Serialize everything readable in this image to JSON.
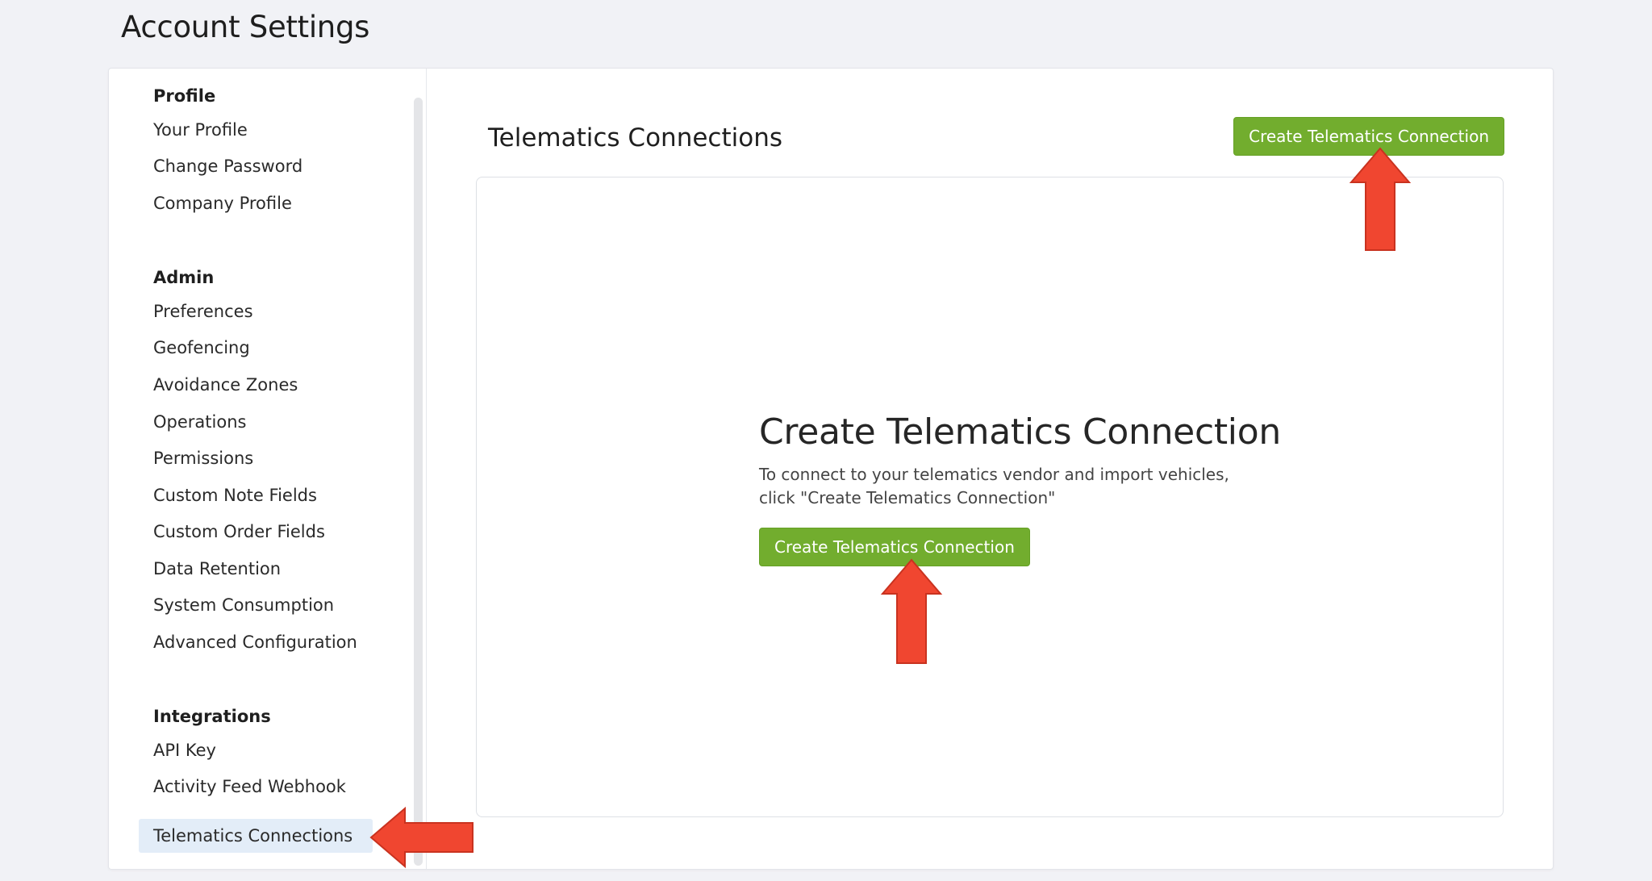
{
  "page": {
    "title": "Account Settings"
  },
  "sidebar": {
    "groups": [
      {
        "heading": "Profile",
        "items": [
          {
            "label": "Your Profile"
          },
          {
            "label": "Change Password"
          },
          {
            "label": "Company Profile"
          }
        ]
      },
      {
        "heading": "Admin",
        "items": [
          {
            "label": "Preferences"
          },
          {
            "label": "Geofencing"
          },
          {
            "label": "Avoidance Zones"
          },
          {
            "label": "Operations"
          },
          {
            "label": "Permissions"
          },
          {
            "label": "Custom Note Fields"
          },
          {
            "label": "Custom Order Fields"
          },
          {
            "label": "Data Retention"
          },
          {
            "label": "System Consumption"
          },
          {
            "label": "Advanced Configuration"
          }
        ]
      },
      {
        "heading": "Integrations",
        "items": [
          {
            "label": "API Key"
          },
          {
            "label": "Activity Feed Webhook"
          },
          {
            "label": "Telematics Connections",
            "active": true
          }
        ]
      }
    ]
  },
  "content": {
    "section_title": "Telematics Connections",
    "create_button_label": "Create Telematics Connection",
    "empty_state": {
      "title": "Create Telematics Connection",
      "description_line1": "To connect to your telematics vendor and import vehicles,",
      "description_line2": "click \"Create Telematics Connection\"",
      "button_label": "Create Telematics Connection"
    }
  },
  "colors": {
    "accent_green": "#72ad2e",
    "annotation_arrow": "#f04630",
    "active_nav_bg": "#e3edf8"
  }
}
